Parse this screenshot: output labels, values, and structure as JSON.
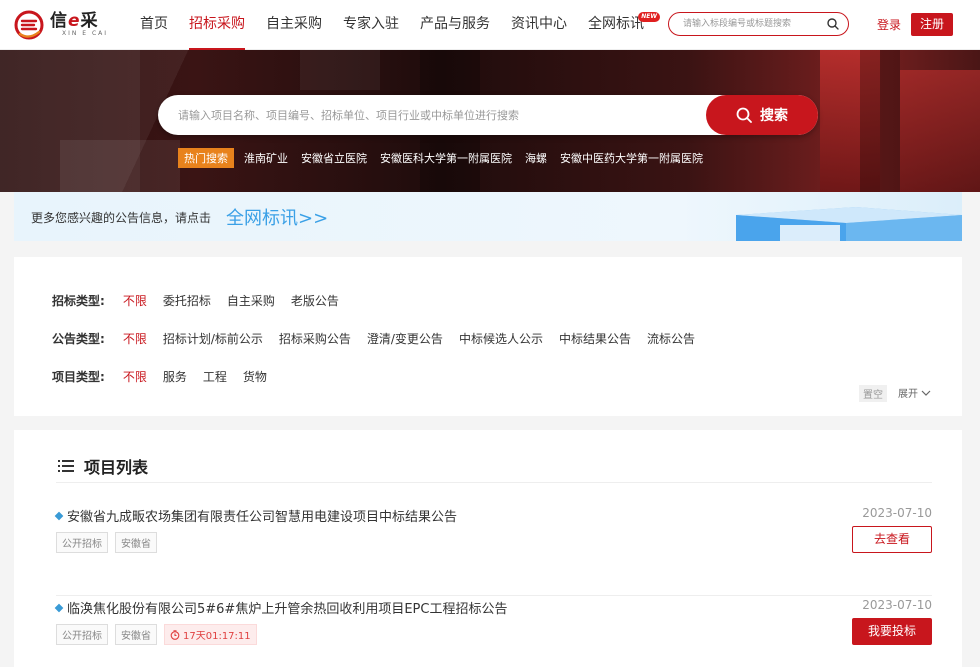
{
  "brand": {
    "name_prefix": "信",
    "name_e": "e",
    "name_suffix": "采",
    "subtitle": "XIN E CAI"
  },
  "nav": [
    {
      "label": "首页",
      "active": false
    },
    {
      "label": "招标采购",
      "active": true
    },
    {
      "label": "自主采购",
      "active": false
    },
    {
      "label": "专家入驻",
      "active": false
    },
    {
      "label": "产品与服务",
      "active": false
    },
    {
      "label": "资讯中心",
      "active": false
    },
    {
      "label": "全网标讯",
      "active": false,
      "badge": "NEW"
    }
  ],
  "header_search": {
    "placeholder": "请输入标段编号或标题搜索"
  },
  "auth": {
    "login": "登录",
    "register": "注册"
  },
  "hero_search": {
    "placeholder": "请输入项目名称、项目编号、招标单位、项目行业或中标单位进行搜索",
    "button": "搜索",
    "hot_label": "热门搜索",
    "hot_items": [
      "淮南矿业",
      "安徽省立医院",
      "安徽医科大学第一附属医院",
      "海螺",
      "安徽中医药大学第一附属医院"
    ]
  },
  "notice": {
    "text": "更多您感兴趣的公告信息，请点击",
    "link": "全网标讯>>"
  },
  "filters": [
    {
      "label": "招标类型:",
      "options": [
        "不限",
        "委托招标",
        "自主采购",
        "老版公告"
      ],
      "selected": 0
    },
    {
      "label": "公告类型:",
      "options": [
        "不限",
        "招标计划/标前公示",
        "招标采购公告",
        "澄清/变更公告",
        "中标候选人公示",
        "中标结果公告",
        "流标公告"
      ],
      "selected": 0
    },
    {
      "label": "项目类型:",
      "options": [
        "不限",
        "服务",
        "工程",
        "货物"
      ],
      "selected": 0
    }
  ],
  "filter_actions": {
    "clear": "置空",
    "expand": "展开"
  },
  "project_list": {
    "title": "项目列表",
    "items": [
      {
        "title": "安徽省九成畈农场集团有限责任公司智慧用电建设项目中标结果公告",
        "tags": [
          "公开招标",
          "安徽省"
        ],
        "timer": "",
        "date": "2023-07-10",
        "action": "去查看",
        "action_style": "outline"
      },
      {
        "title": "临涣焦化股份有限公司5#6#焦炉上升管余热回收利用项目EPC工程招标公告",
        "tags": [
          "公开招标",
          "安徽省"
        ],
        "timer": "17天01:17:11",
        "date": "2023-07-10",
        "action": "我要投标",
        "action_style": "solid"
      }
    ]
  },
  "colors": {
    "brand": "#c8161d",
    "hot_tag": "#e8821c",
    "link_blue": "#3aa0e6"
  }
}
